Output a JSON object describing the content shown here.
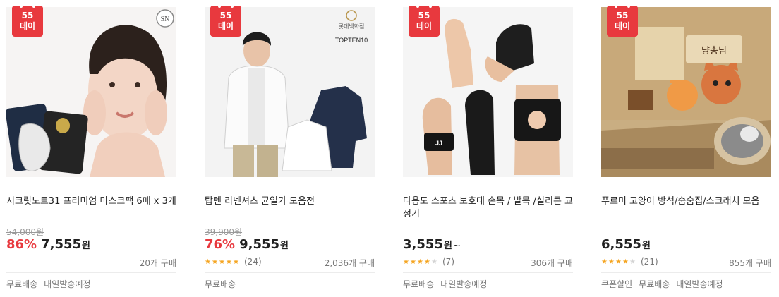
{
  "accent_color": "#e8393e",
  "badge": {
    "line1": "55",
    "line2": "데이"
  },
  "products": [
    {
      "title": "시크릿노트31 프리미엄 마스크팩 6매 x 3개",
      "original_price": "54,000원",
      "discount": "86%",
      "price": "7,555",
      "currency": "원",
      "suffix": "",
      "rating": null,
      "review_count": "",
      "sold": "20개 구매",
      "tags": [
        "무료배송",
        "내일발송예정"
      ]
    },
    {
      "title": "탑텐 리넨셔츠 균일가 모음전",
      "original_price": "39,900원",
      "discount": "76%",
      "price": "9,555",
      "currency": "원",
      "suffix": "",
      "rating": 5,
      "review_count": "(24)",
      "sold": "2,036개 구매",
      "tags": [
        "무료배송"
      ]
    },
    {
      "title": "다용도 스포츠 보호대 손목 / 발목 /실리콘 교정기",
      "original_price": "",
      "discount": "",
      "price": "3,555",
      "currency": "원",
      "suffix": "~",
      "rating": 4,
      "review_count": "(7)",
      "sold": "306개 구매",
      "tags": [
        "무료배송",
        "내일발송예정"
      ]
    },
    {
      "title": "푸르미 고양이 방석/숨숨집/스크래처 모음",
      "original_price": "",
      "discount": "",
      "price": "6,555",
      "currency": "원",
      "suffix": "",
      "rating": 4.5,
      "review_count": "(21)",
      "sold": "855개 구매",
      "tags": [
        "쿠폰할인",
        "무료배송",
        "내일발송예정"
      ]
    }
  ]
}
